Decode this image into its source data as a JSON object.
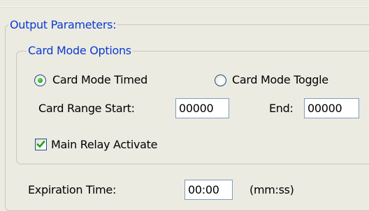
{
  "output_parameters": {
    "legend": "Output Parameters:",
    "card_mode_options": {
      "legend": "Card Mode Options",
      "radio_timed": {
        "label": "Card Mode Timed",
        "selected": true
      },
      "radio_toggle": {
        "label": "Card Mode Toggle",
        "selected": false
      },
      "card_range_start": {
        "label": "Card Range Start:",
        "value": "00000"
      },
      "card_range_end": {
        "label": "End:",
        "value": "00000"
      },
      "main_relay": {
        "label": "Main Relay Activate",
        "checked": true
      }
    },
    "expiration_time": {
      "label": "Expiration Time:",
      "value": "00:00",
      "unit": "(mm:ss)"
    }
  },
  "colors": {
    "background": "#ecebe2",
    "legend_text": "#0a3bd2",
    "group_border": "#c9c7ba",
    "input_border": "#7f9db9",
    "radio_selected_dot": "#21a121",
    "checkmark": "#21a121"
  }
}
